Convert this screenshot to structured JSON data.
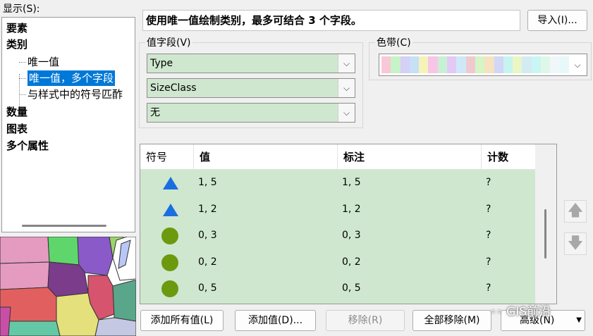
{
  "show": {
    "label": "显示(S):",
    "tree": [
      {
        "label": "要素",
        "bold": true
      },
      {
        "label": "类别",
        "bold": true
      },
      {
        "label": "唯一值",
        "bold": false
      },
      {
        "label": "唯一值，多个字段",
        "bold": false,
        "selected": true
      },
      {
        "label": "与样式中的符号匹酢",
        "bold": false
      },
      {
        "label": "数量",
        "bold": true
      },
      {
        "label": "图表",
        "bold": true
      },
      {
        "label": "多个属性",
        "bold": true
      }
    ]
  },
  "description": "使用唯一值绘制类别，最多可结合 3 个字段。",
  "import_button": "导入(I)...",
  "value_fields": {
    "title": "值字段(V)",
    "fields": [
      "Type",
      "SizeClass",
      "无"
    ]
  },
  "color_ramp": {
    "title": "色带(C)",
    "colors": [
      "#f9c8d6",
      "#c8f2c8",
      "#d5d0f5",
      "#c5e0f7",
      "#f6f3b8",
      "#f7c6e6",
      "#c9f0d4",
      "#e3c9f5",
      "#cfe8f7",
      "#f0c9d0",
      "#d6f4c4",
      "#f6e2c0",
      "#d0d7f7",
      "#c8f4ef",
      "#eaf6c6",
      "#d3ecf4",
      "#c9f6f3",
      "#dff7e9",
      "#f0f7fa",
      "#e8f8f8"
    ]
  },
  "table": {
    "columns": [
      "符号",
      "值",
      "标注",
      "计数"
    ],
    "rows": [
      {
        "symbol": "triangle",
        "value": "1, 5",
        "label": "1, 5",
        "count": "?"
      },
      {
        "symbol": "triangle",
        "value": "1, 2",
        "label": "1, 2",
        "count": "?"
      },
      {
        "symbol": "circle",
        "value": "0, 3",
        "label": "0, 3",
        "count": "?"
      },
      {
        "symbol": "circle",
        "value": "0, 2",
        "label": "0, 2",
        "count": "?"
      },
      {
        "symbol": "circle",
        "value": "0, 5",
        "label": "0, 5",
        "count": "?"
      }
    ],
    "symbol_colors": {
      "triangle": "#1a6fe0",
      "circle": "#6b9a0e"
    }
  },
  "buttons": {
    "add_all": "添加所有值(L)",
    "add_values": "添加值(D)...",
    "remove": "移除(R)",
    "remove_all": "全部移除(M)",
    "advanced": "高级(N)"
  },
  "watermark": "GIS前沿"
}
